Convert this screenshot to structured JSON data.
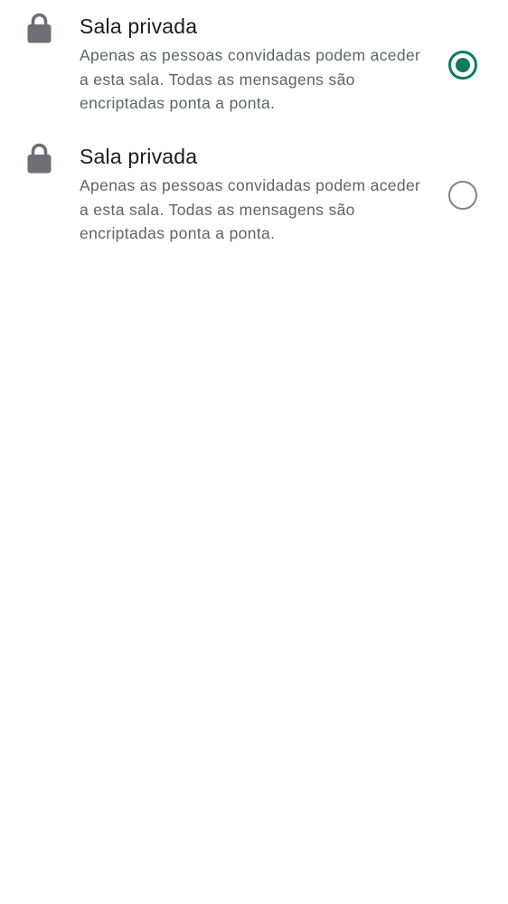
{
  "options": [
    {
      "icon": "lock-icon",
      "title": "Sala privada",
      "description": "Apenas as pessoas convidadas podem aceder a esta sala. Todas as mensagens são encriptadas ponta a ponta.",
      "selected": true
    },
    {
      "icon": "lock-icon",
      "title": "Sala privada",
      "description": "Apenas as pessoas convidadas podem aceder a esta sala. Todas as mensagens são encriptadas ponta a ponta.",
      "selected": false
    }
  ],
  "colors": {
    "accent": "#0b7c5d",
    "icon": "#6c6f76",
    "title": "#1b1c1e",
    "description": "#5f6368",
    "radio_unchecked": "#808288"
  }
}
